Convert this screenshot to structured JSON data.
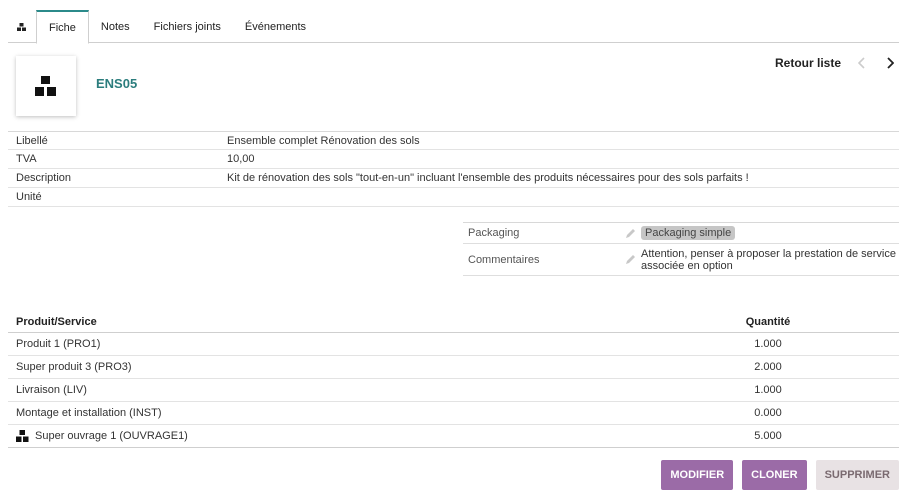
{
  "tabs": [
    {
      "label": "",
      "icon": "object-icon"
    },
    {
      "label": "Fiche"
    },
    {
      "label": "Notes"
    },
    {
      "label": "Fichiers joints"
    },
    {
      "label": "Événements"
    }
  ],
  "header": {
    "ref": "ENS05",
    "back_label": "Retour liste"
  },
  "fields": [
    {
      "label": "Libellé",
      "value": "Ensemble complet Rénovation des sols"
    },
    {
      "label": "TVA",
      "value": "10,00"
    },
    {
      "label": "Description",
      "value": "Kit de rénovation des sols \"tout-en-un\" incluant l'ensemble des produits nécessaires pour des sols parfaits !"
    },
    {
      "label": "Unité",
      "value": ""
    }
  ],
  "extras": {
    "packaging": {
      "label": "Packaging",
      "value": "Packaging simple"
    },
    "comment": {
      "label": "Commentaires",
      "value": "Attention, penser à proposer la prestation de service associée en option"
    }
  },
  "lines": {
    "headers": {
      "product": "Produit/Service",
      "qty": "Quantité"
    },
    "rows": [
      {
        "product": "Produit 1 (PRO1)",
        "qty": "1.000"
      },
      {
        "product": "Super produit 3 (PRO3)",
        "qty": "2.000"
      },
      {
        "product": "Livraison (LIV)",
        "qty": "1.000"
      },
      {
        "product": "Montage et installation (INST)",
        "qty": "0.000"
      },
      {
        "product": "Super ouvrage 1 (OUVRAGE1)",
        "qty": "5.000"
      }
    ]
  },
  "actions": {
    "modify": "MODIFIER",
    "clone": "CLONER",
    "delete": "SUPPRIMER"
  },
  "colors": {
    "accent": "#2b7d7d",
    "button": "#9b6ba7",
    "button_light": "#e8e2e4"
  }
}
